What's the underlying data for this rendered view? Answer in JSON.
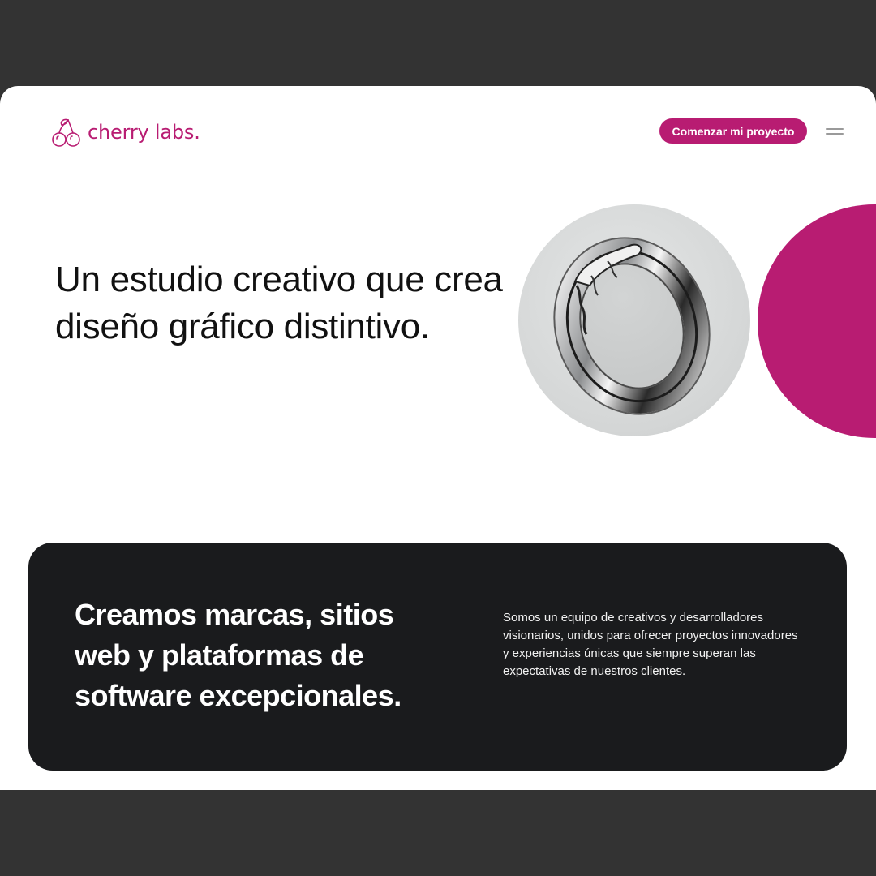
{
  "header": {
    "logo_text": "cherry labs.",
    "cta_label": "Comenzar mi proyecto"
  },
  "hero": {
    "title": "Un estudio creativo que crea diseño gráfico distintivo."
  },
  "card": {
    "title": "Creamos marcas, sitios web y plataformas de software excepcionales.",
    "text": "Somos un equipo de creativos y desarrolladores visionarios, unidos para ofrecer proyectos innovadores y experiencias únicas que siempre superan las expectativas de nuestros clientes."
  },
  "colors": {
    "brand": "#b81c72",
    "dark_card": "#1a1b1d",
    "backdrop": "#333333"
  },
  "icons": {
    "logo": "cherry-icon",
    "menu": "hamburger-menu-icon"
  }
}
